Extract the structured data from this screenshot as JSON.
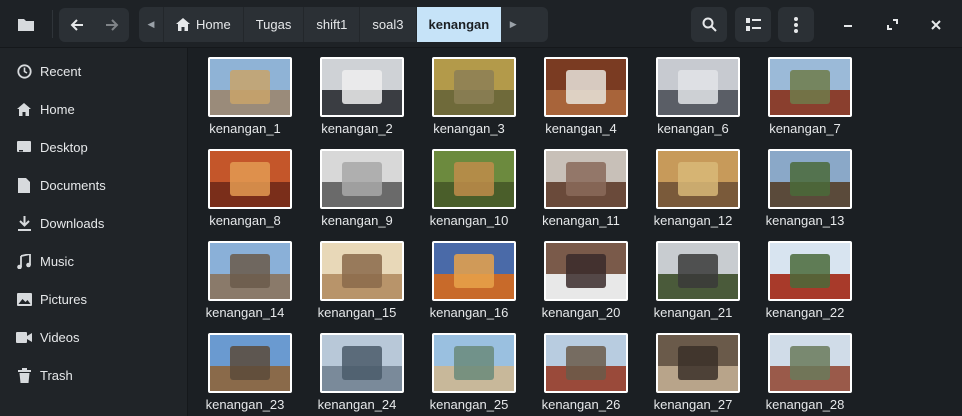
{
  "header": {
    "crumbs": [
      "Home",
      "Tugas",
      "shift1",
      "soal3",
      "kenangan"
    ]
  },
  "sidebar": {
    "items": [
      {
        "label": "Recent",
        "icon": "clock-icon"
      },
      {
        "label": "Home",
        "icon": "home-icon"
      },
      {
        "label": "Desktop",
        "icon": "desktop-icon"
      },
      {
        "label": "Documents",
        "icon": "document-icon"
      },
      {
        "label": "Downloads",
        "icon": "download-icon"
      },
      {
        "label": "Music",
        "icon": "music-icon"
      },
      {
        "label": "Pictures",
        "icon": "picture-icon"
      },
      {
        "label": "Videos",
        "icon": "video-icon"
      },
      {
        "label": "Trash",
        "icon": "trash-icon"
      }
    ]
  },
  "files": [
    {
      "name": "kenangan_1",
      "colors": [
        "#8fb3d6",
        "#9a8b7a",
        "#c9a36a"
      ]
    },
    {
      "name": "kenangan_2",
      "colors": [
        "#cfd2d6",
        "#3a3d42",
        "#eeeeee"
      ]
    },
    {
      "name": "kenangan_3",
      "colors": [
        "#b39a4a",
        "#6f6a3a",
        "#8c7f56"
      ]
    },
    {
      "name": "kenangan_4",
      "colors": [
        "#7a3b22",
        "#a8643a",
        "#e8e4dc"
      ]
    },
    {
      "name": "kenangan_6",
      "colors": [
        "#c7cad0",
        "#5a5e66",
        "#e2e4e8"
      ]
    },
    {
      "name": "kenangan_7",
      "colors": [
        "#9bbad8",
        "#8a3f2e",
        "#6e7b4a"
      ]
    },
    {
      "name": "kenangan_8",
      "colors": [
        "#c4562a",
        "#7a2e1a",
        "#e39a52"
      ]
    },
    {
      "name": "kenangan_9",
      "colors": [
        "#d8d8d8",
        "#6a6a6a",
        "#a8a8a8"
      ]
    },
    {
      "name": "kenangan_10",
      "colors": [
        "#6c8a3e",
        "#4a5e2a",
        "#c08c4a"
      ]
    },
    {
      "name": "kenangan_11",
      "colors": [
        "#c8c0b8",
        "#6a4a3a",
        "#8a6a5a"
      ]
    },
    {
      "name": "kenangan_12",
      "colors": [
        "#c79a5a",
        "#7a5a3a",
        "#d8b878"
      ]
    },
    {
      "name": "kenangan_13",
      "colors": [
        "#8aa8c8",
        "#5a4a3a",
        "#4a6a3a"
      ]
    },
    {
      "name": "kenangan_14",
      "colors": [
        "#8ab0d8",
        "#8a7a6a",
        "#6a5a4a"
      ]
    },
    {
      "name": "kenangan_15",
      "colors": [
        "#e8d8b8",
        "#b8946a",
        "#8a6a4a"
      ]
    },
    {
      "name": "kenangan_16",
      "colors": [
        "#4a6aa8",
        "#c86a2a",
        "#e8a24a"
      ]
    },
    {
      "name": "kenangan_20",
      "colors": [
        "#7a5a4a",
        "#e8e8e8",
        "#3a2a2a"
      ]
    },
    {
      "name": "kenangan_21",
      "colors": [
        "#c8ccd0",
        "#4a5a3a",
        "#3a3a3a"
      ]
    },
    {
      "name": "kenangan_22",
      "colors": [
        "#d8e4f0",
        "#a83a2a",
        "#4a6a3a"
      ]
    },
    {
      "name": "kenangan_23",
      "colors": [
        "#6a9ad0",
        "#8a6a4a",
        "#5a4a3a"
      ]
    },
    {
      "name": "kenangan_24",
      "colors": [
        "#b8c8d8",
        "#7a8a9a",
        "#4a5a6a"
      ]
    },
    {
      "name": "kenangan_25",
      "colors": [
        "#9ac0e0",
        "#c8b89a",
        "#6a8a7a"
      ]
    },
    {
      "name": "kenangan_26",
      "colors": [
        "#b8cce0",
        "#9a4a3a",
        "#6a5a4a"
      ]
    },
    {
      "name": "kenangan_27",
      "colors": [
        "#6a5a4a",
        "#b8a48a",
        "#3a3028"
      ]
    },
    {
      "name": "kenangan_28",
      "colors": [
        "#d0dce8",
        "#9a5a4a",
        "#6a7a5a"
      ]
    }
  ]
}
